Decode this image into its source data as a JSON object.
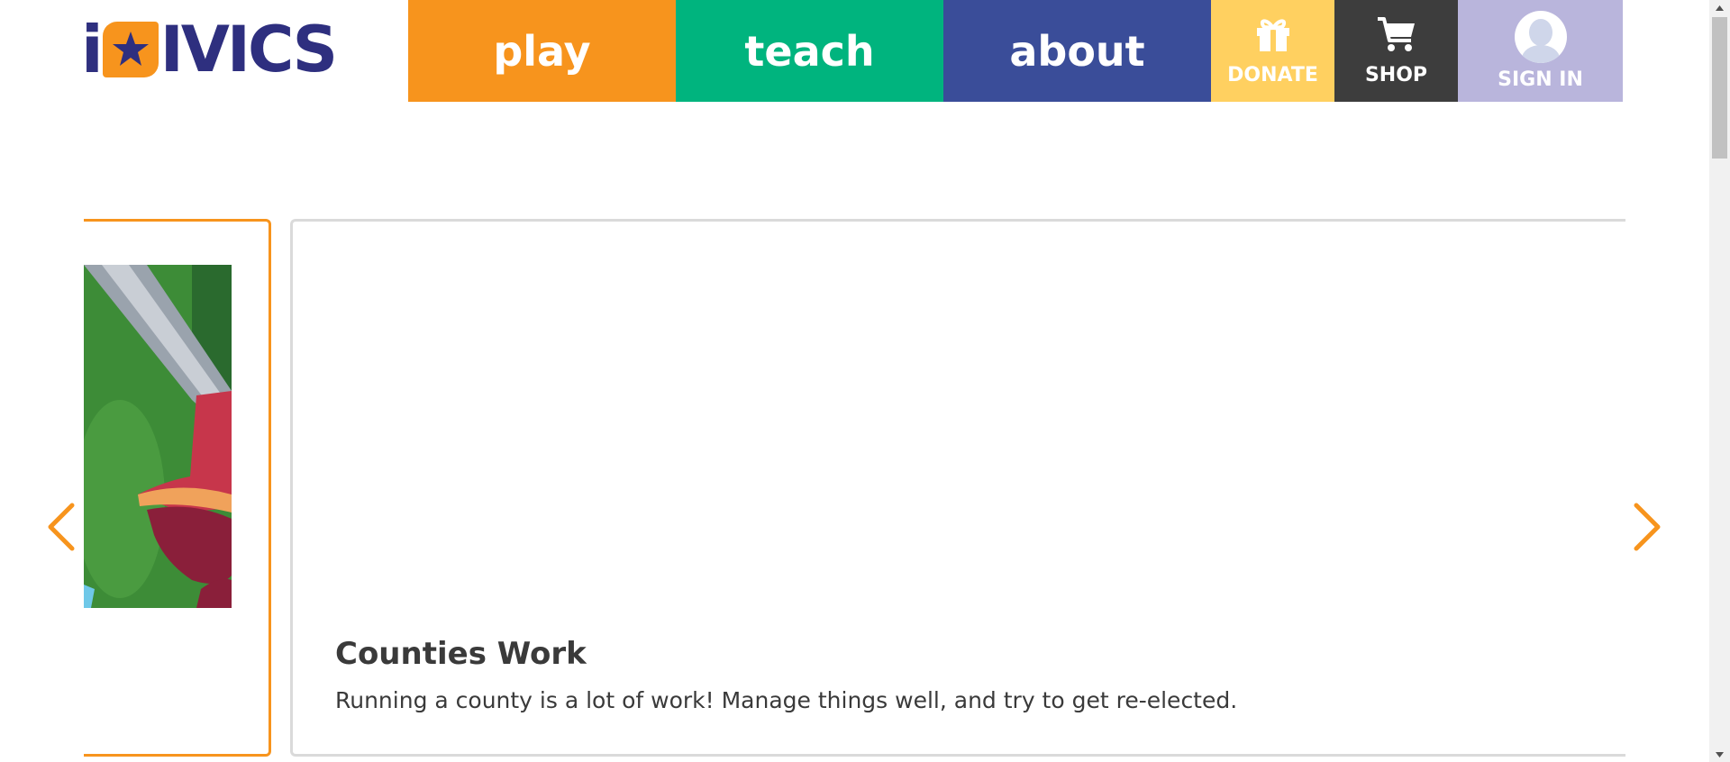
{
  "brand": {
    "name": "iCivics"
  },
  "nav": {
    "play": "play",
    "teach": "teach",
    "about": "about",
    "donate": "DONATE",
    "shop": "SHOP",
    "sign_in": "SIGN IN"
  },
  "colors": {
    "play": "#f7941d",
    "teach": "#00b47e",
    "about": "#3a4d99",
    "donate": "#ffd060",
    "shop": "#3d3d3d",
    "sign_in": "#b9b5dc",
    "accent": "#f7941d",
    "logo_navy": "#2e2f7f"
  },
  "icons": {
    "donate": "gift-icon",
    "shop": "cart-icon",
    "sign_in": "user-avatar-icon",
    "prev": "chevron-left-icon",
    "next": "chevron-right-icon"
  },
  "carousel": {
    "current": {
      "title": "Counties Work",
      "description": "Running a county is a lot of work! Manage things well, and try to get re-elected."
    }
  }
}
